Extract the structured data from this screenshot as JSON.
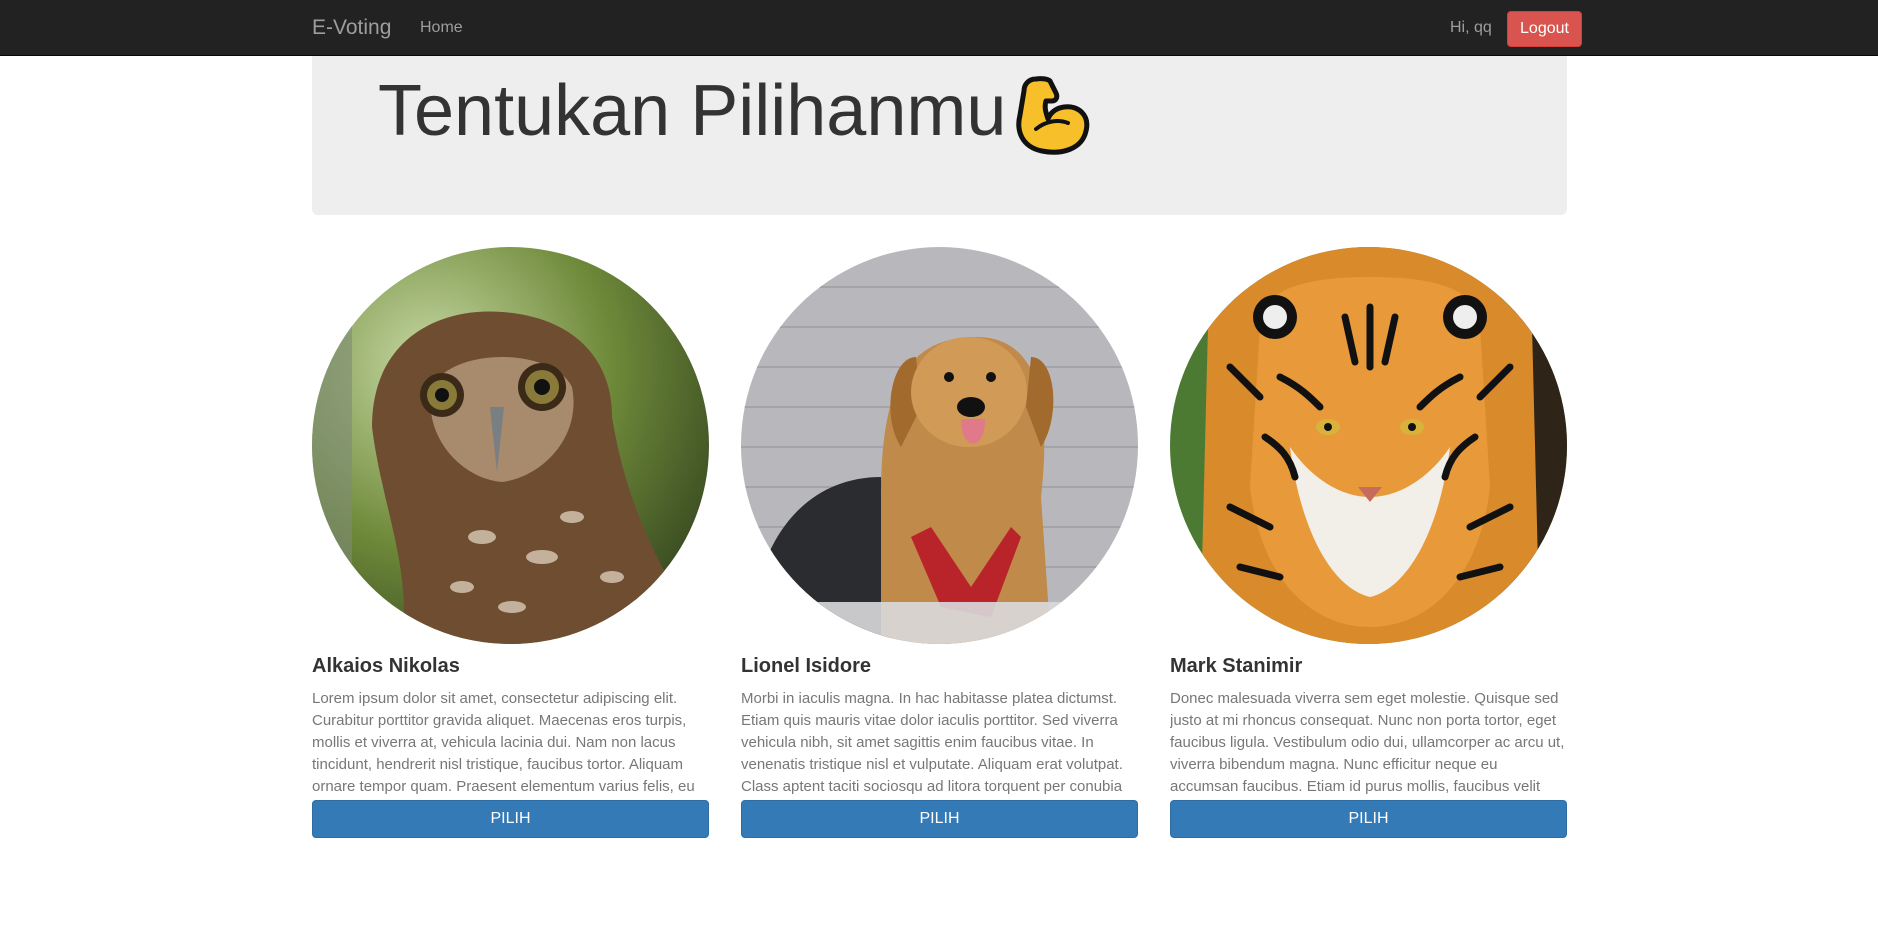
{
  "navbar": {
    "brand": "E-Voting",
    "home_label": "Home",
    "greeting": "Hi, qq",
    "logout_label": "Logout"
  },
  "hero": {
    "title": "Tentukan Pilihanmu",
    "icon": "flexed-biceps-icon"
  },
  "candidates": [
    {
      "name": "Alkaios Nikolas",
      "photo": "owl-photo",
      "description": "Lorem ipsum dolor sit amet, consectetur adipiscing elit. Curabitur porttitor gravida aliquet. Maecenas eros turpis, mollis et viverra at, vehicula lacinia dui. Nam non lacus tincidunt, hendrerit nisl tristique, faucibus tortor. Aliquam ornare tempor quam. Praesent elementum varius felis, eu tempor metus finibus vitae.",
      "button_label": "PILIH"
    },
    {
      "name": "Lionel Isidore",
      "photo": "dog-photo",
      "description": "Morbi in iaculis magna. In hac habitasse platea dictumst. Etiam quis mauris vitae dolor iaculis porttitor. Sed viverra vehicula nibh, sit amet sagittis enim faucibus vitae. In venenatis tristique nisl et vulputate. Aliquam erat volutpat. Class aptent taciti sociosqu ad litora torquent per conubia nostra, per inceptos himenaeos.",
      "button_label": "PILIH"
    },
    {
      "name": "Mark Stanimir",
      "photo": "tiger-photo",
      "description": "Donec malesuada viverra sem eget molestie. Quisque sed justo at mi rhoncus consequat. Nunc non porta tortor, eget faucibus ligula. Vestibulum odio dui, ullamcorper ac arcu ut, viverra bibendum magna. Nunc efficitur neque eu accumsan faucibus. Etiam id purus mollis, faucibus velit vitae, vehicula tortor.",
      "button_label": "PILIH"
    }
  ],
  "colors": {
    "navbar_bg": "#222222",
    "logout_bg": "#d9534f",
    "primary_button": "#337ab7",
    "jumbotron_bg": "#eeeeee"
  }
}
